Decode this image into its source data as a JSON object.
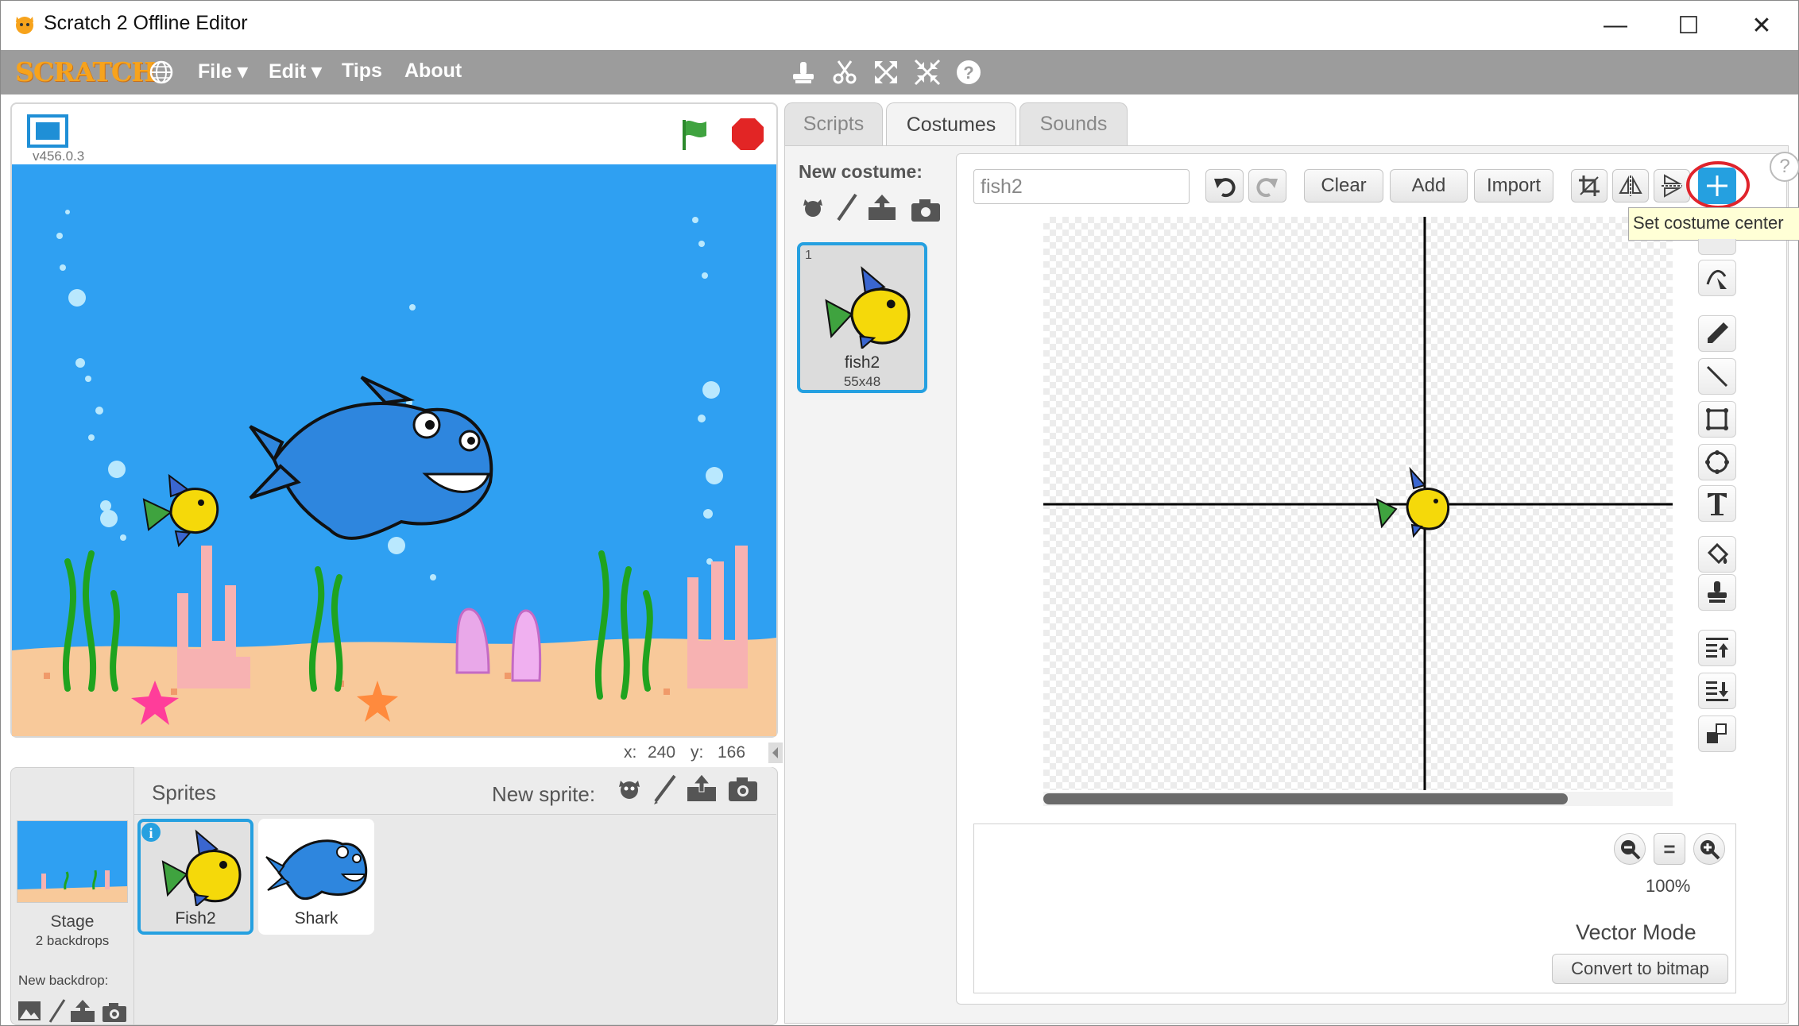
{
  "window": {
    "title": "Scratch 2 Offline Editor",
    "minimize": "—",
    "maximize": "☐",
    "close": "✕"
  },
  "menubar": {
    "logo": "SCRATCH",
    "items": [
      "File ▾",
      "Edit ▾",
      "Tips",
      "About"
    ]
  },
  "stage": {
    "version": "v456.0.3",
    "x_label": "x:",
    "x_value": "240",
    "y_label": "y:",
    "y_value": "166"
  },
  "sprites": {
    "header": "Sprites",
    "new_sprite_label": "New sprite:",
    "stage_name": "Stage",
    "stage_backdrops": "2 backdrops",
    "new_backdrop_label": "New backdrop:",
    "list": [
      {
        "name": "Fish2",
        "selected": true
      },
      {
        "name": "Shark",
        "selected": false
      }
    ]
  },
  "tabs": [
    {
      "label": "Scripts",
      "active": false
    },
    {
      "label": "Costumes",
      "active": true
    },
    {
      "label": "Sounds",
      "active": false
    }
  ],
  "costumes": {
    "new_costume_label": "New costume:",
    "items": [
      {
        "index": "1",
        "name": "fish2",
        "size": "55x48"
      }
    ]
  },
  "editor": {
    "costume_name": "fish2",
    "clear_label": "Clear",
    "add_label": "Add",
    "import_label": "Import",
    "tooltip": "Set costume center",
    "zoom_level": "100%",
    "mode_label": "Vector Mode",
    "convert_label": "Convert to bitmap",
    "help_label": "?",
    "zoom_out": "−",
    "zoom_reset": "=",
    "zoom_in": "+"
  },
  "colors": {
    "accent": "#25a0e0",
    "menubar": "#9c9c9c",
    "stage_water": "#2fa0f2",
    "highlight_ring": "#e0242c"
  }
}
